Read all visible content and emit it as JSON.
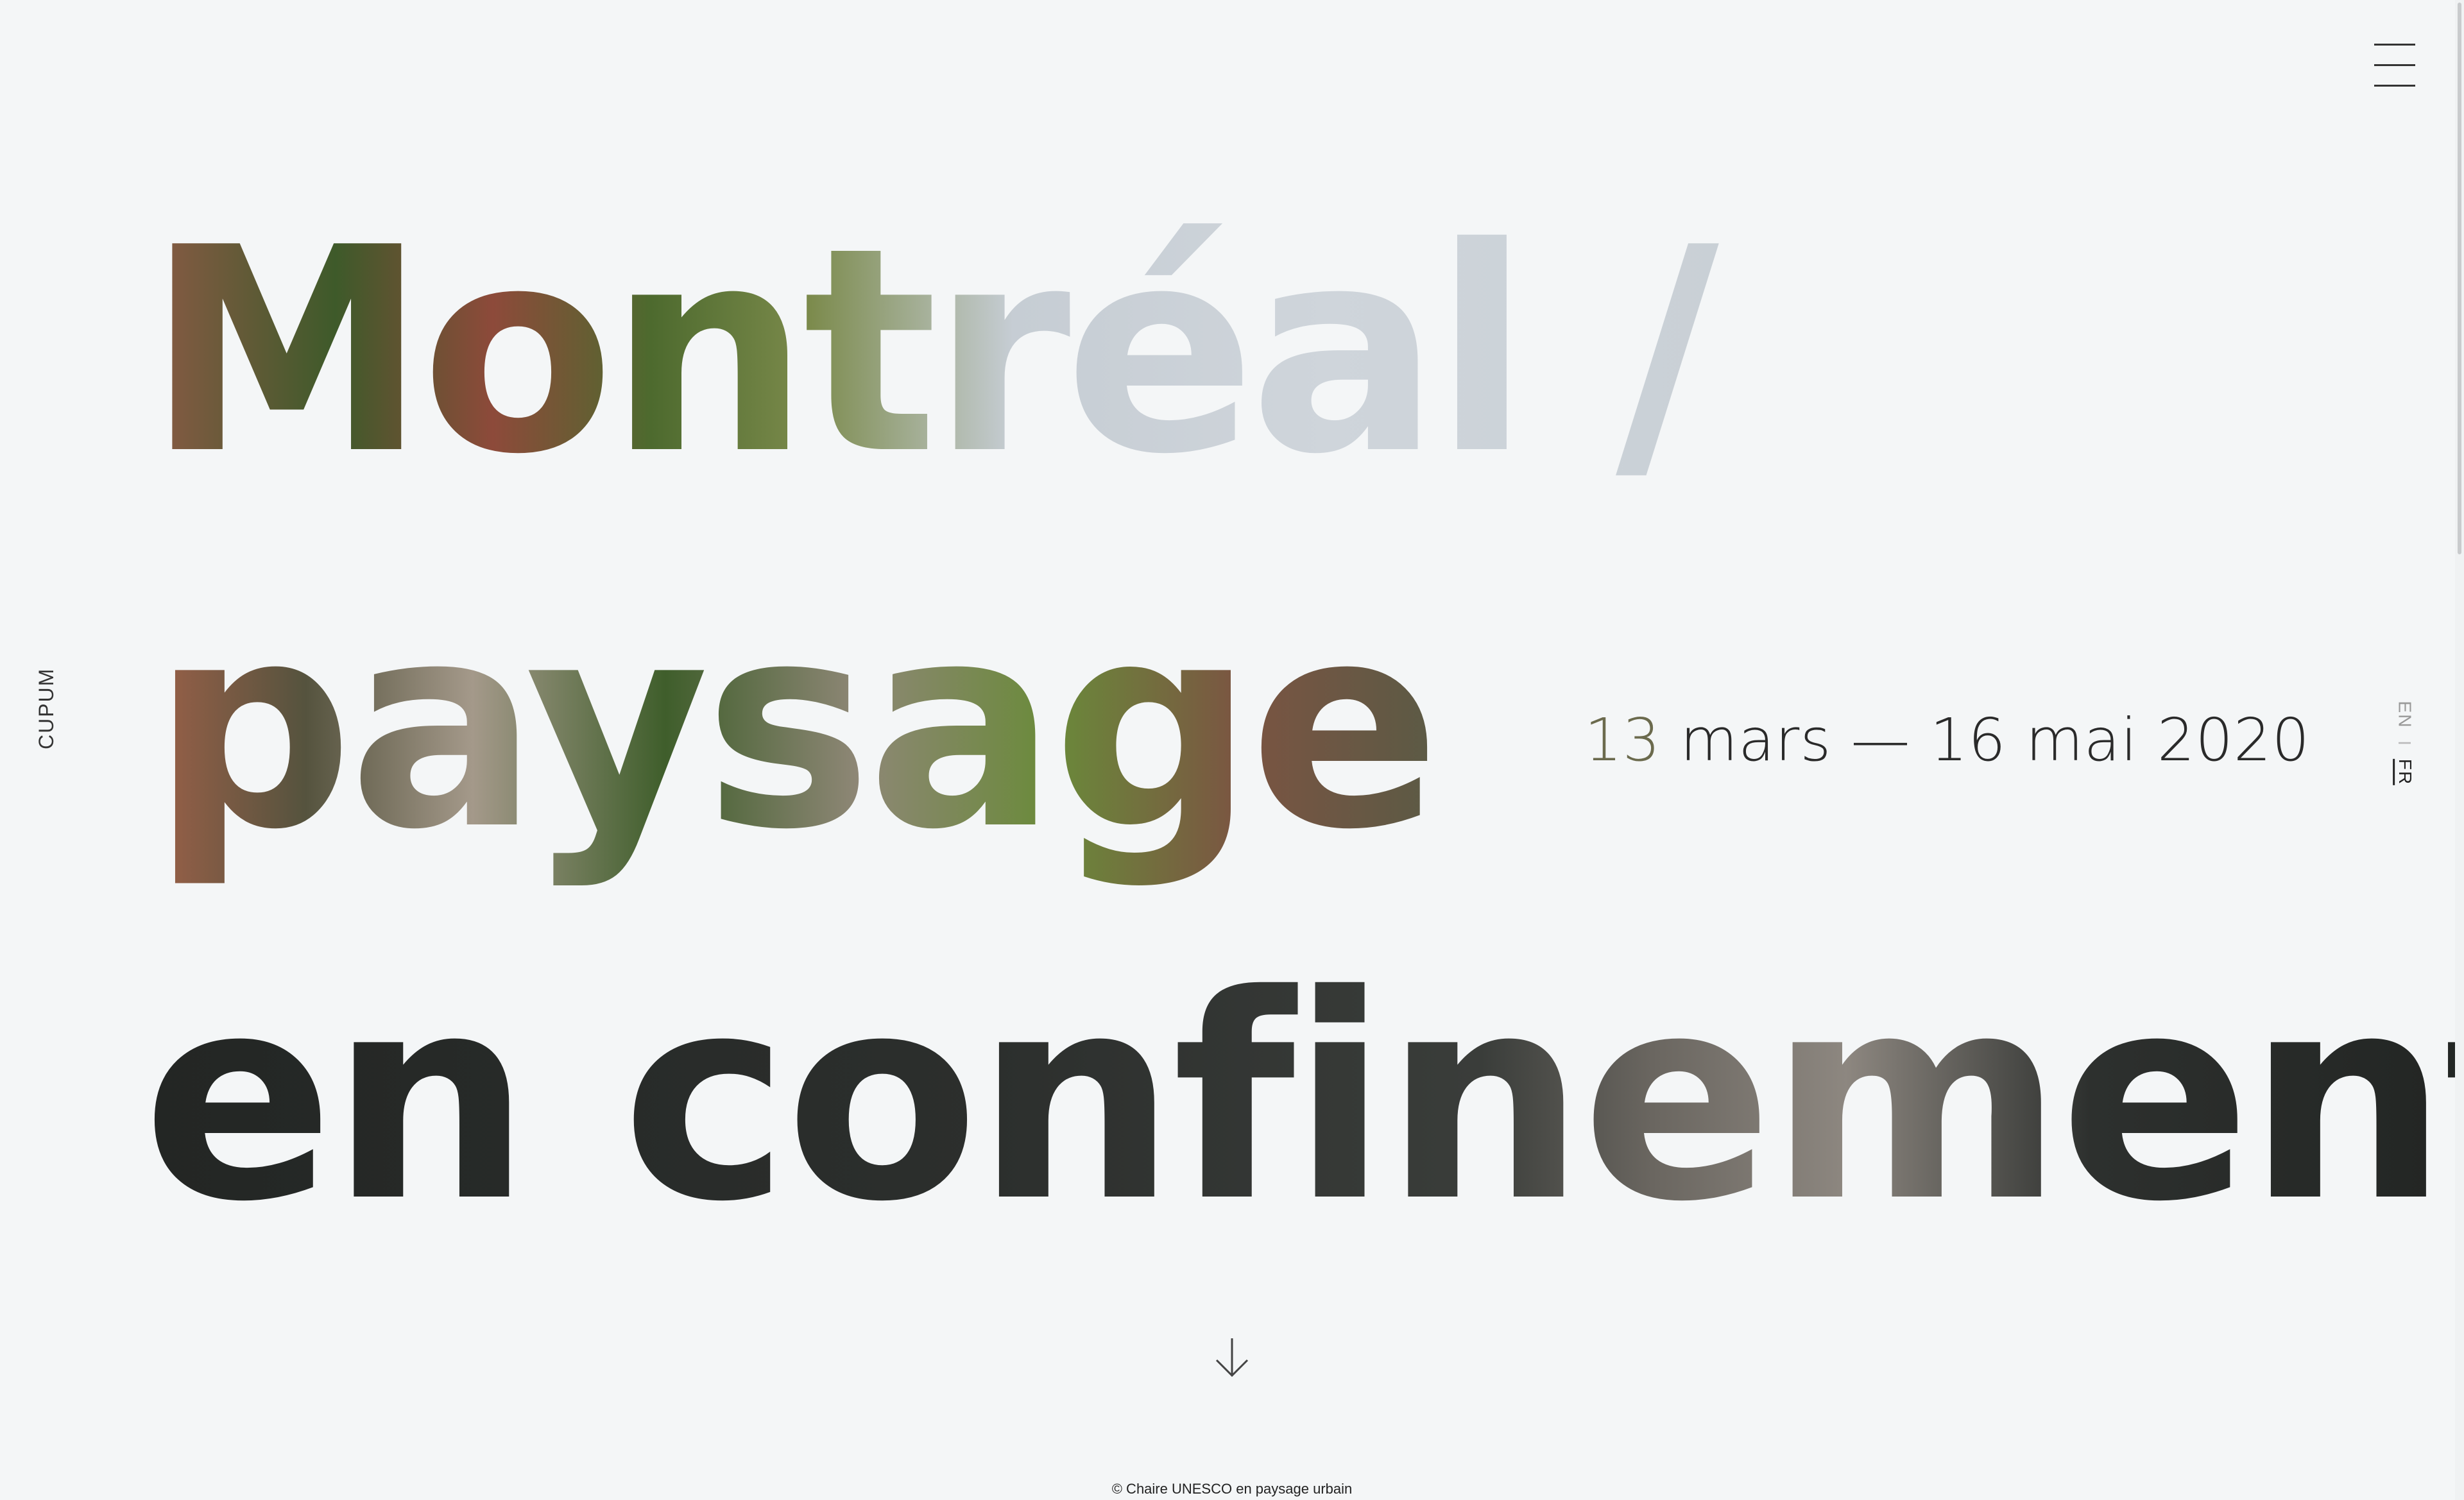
{
  "headline": {
    "line1": "Montréal /",
    "line2": "paysage",
    "line3": "en confinement"
  },
  "sidebar_left_label": "CUPUM",
  "date_range": {
    "first_char": "13",
    "rest": " mars — 16 mai 2020"
  },
  "language": {
    "en": "EN",
    "separator": "I",
    "fr": "FR",
    "active": "FR"
  },
  "footer": {
    "copyright": "© Chaire UNESCO en paysage urbain"
  },
  "icons": {
    "menu": "hamburger-icon",
    "scroll": "arrow-down-icon"
  },
  "colors": {
    "background": "#f4f6f7",
    "text_dark": "#222222",
    "photo_brick": "#a0553f",
    "photo_green": "#4f6b2e",
    "photo_sky": "#c8cfd6",
    "photo_dark": "#2b2f2d"
  }
}
